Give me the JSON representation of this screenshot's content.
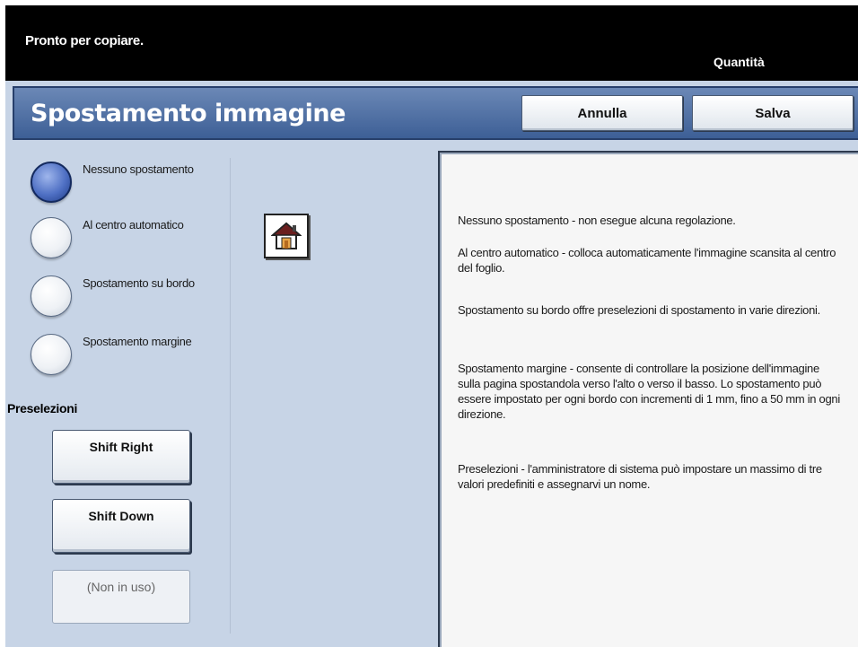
{
  "status_bar": {
    "message": "Pronto per copiare.",
    "quantity_label": "Quantità"
  },
  "header": {
    "title": "Spostamento immagine",
    "cancel_label": "Annulla",
    "save_label": "Salva"
  },
  "options": [
    {
      "label": "Nessuno spostamento",
      "selected": true
    },
    {
      "label": "Al centro automatico",
      "selected": false
    },
    {
      "label": "Spostamento su bordo",
      "selected": false
    },
    {
      "label": "Spostamento margine",
      "selected": false
    }
  ],
  "presets": {
    "label": "Preselezioni",
    "buttons": [
      "Shift Right",
      "Shift Down",
      "(Non in uso)"
    ]
  },
  "home_icon": "home-icon",
  "info": [
    "Nessuno spostamento - non esegue alcuna regolazione.",
    "Al centro automatico - colloca automaticamente l'immagine scansita al centro del foglio.",
    "Spostamento su bordo offre preselezioni di spostamento in varie direzioni.",
    "Spostamento margine - consente di controllare la posizione dell'immagine sulla pagina spostandola verso l'alto o verso il basso. Lo spostamento può essere impostato per ogni bordo con incrementi di 1 mm, fino a 50 mm in ogni direzione.",
    "Preselezioni - l'amministratore di sistema può impostare un massimo di tre valori predefiniti e assegnarvi un nome."
  ],
  "colors": {
    "background": "#c7d4e6",
    "header": "#4a6ba3",
    "selected_radio": "#3a5bb0"
  }
}
